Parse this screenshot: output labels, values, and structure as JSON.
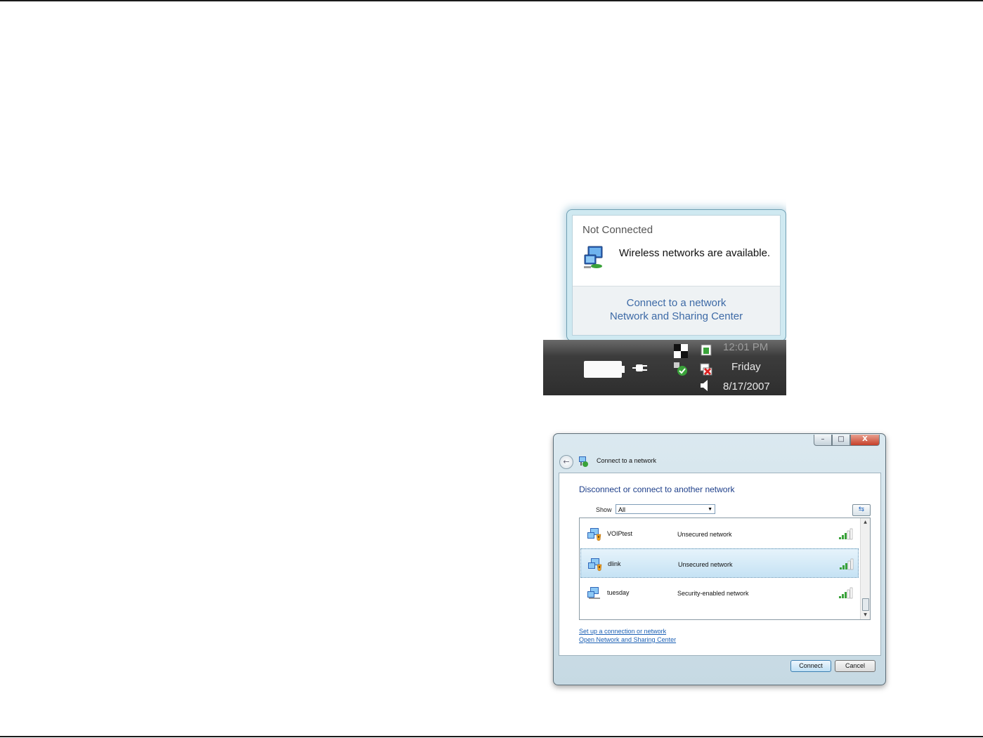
{
  "balloon": {
    "title": "Not Connected",
    "message": "Wireless networks are available.",
    "links": [
      "Connect to a network",
      "Network and Sharing Center"
    ]
  },
  "taskbar": {
    "time": "12:01 PM",
    "day": "Friday",
    "date": "8/17/2007"
  },
  "dialog": {
    "title": "Connect to a network",
    "heading": "Disconnect or connect to another network",
    "show_label": "Show",
    "show_value": "All",
    "title_buttons": [
      "–",
      "□",
      "X"
    ],
    "networks": [
      {
        "name": "VOIPtest",
        "status": "Unsecured network",
        "selected": false
      },
      {
        "name": "dlink",
        "status": "Unsecured network",
        "selected": true
      },
      {
        "name": "tuesday",
        "status": "Security-enabled network",
        "selected": false
      }
    ],
    "links": {
      "setup": "Set up a connection or network",
      "nsc": "Open Network and Sharing Center"
    },
    "connect_label": "Connect",
    "cancel_label": "Cancel"
  },
  "colors": {
    "link_blue": "#3d6aa6",
    "heading_blue": "#1e3f8a",
    "selection": "#c5e2f4",
    "signal_green": "#3aa23a"
  }
}
